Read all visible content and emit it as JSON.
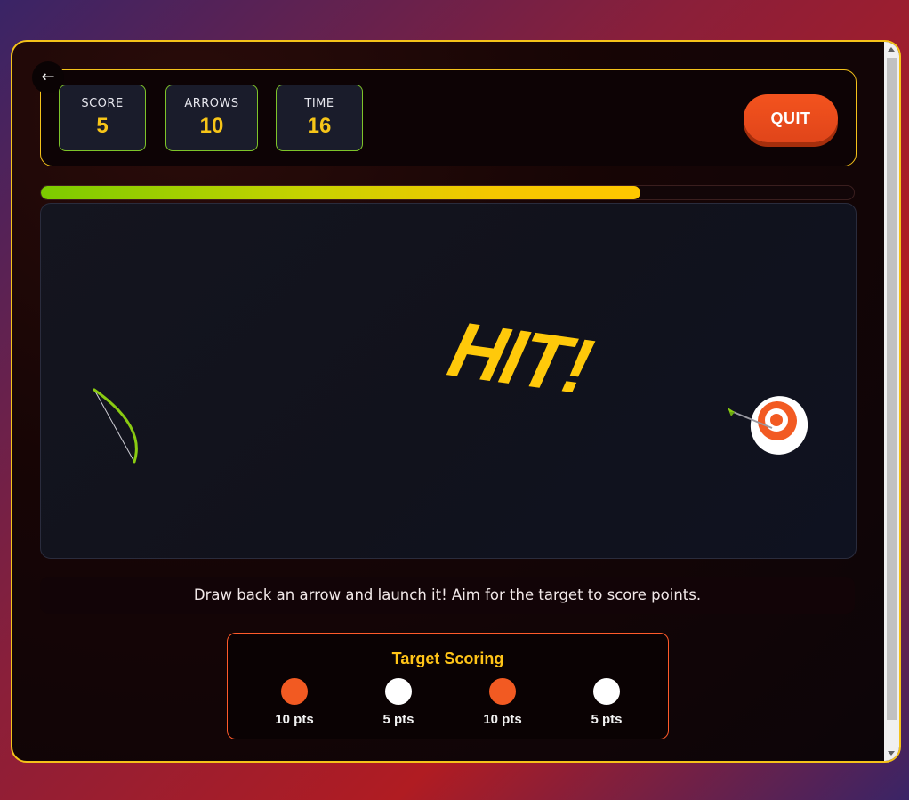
{
  "nav": {
    "back_label": "←"
  },
  "hud": {
    "stats": [
      {
        "label": "SCORE",
        "value": "5"
      },
      {
        "label": "ARROWS",
        "value": "10"
      },
      {
        "label": "TIME",
        "value": "16"
      }
    ],
    "quit_label": "QUIT"
  },
  "progress": {
    "fraction": 0.737
  },
  "arena": {
    "hit_text": "HIT!"
  },
  "instructions": "Draw back an arrow and launch it! Aim for the target to score points.",
  "scoring": {
    "title": "Target Scoring",
    "zones": [
      {
        "color": "#f25a22",
        "label": "10 pts"
      },
      {
        "color": "#ffffff",
        "label": "5 pts"
      },
      {
        "color": "#f25a22",
        "label": "10 pts"
      },
      {
        "color": "#ffffff",
        "label": "5 pts"
      }
    ]
  },
  "colors": {
    "accent": "#f4c21a",
    "target_red": "#f25a22",
    "bow": "#8acb12",
    "quit": "#ec4c1c"
  }
}
